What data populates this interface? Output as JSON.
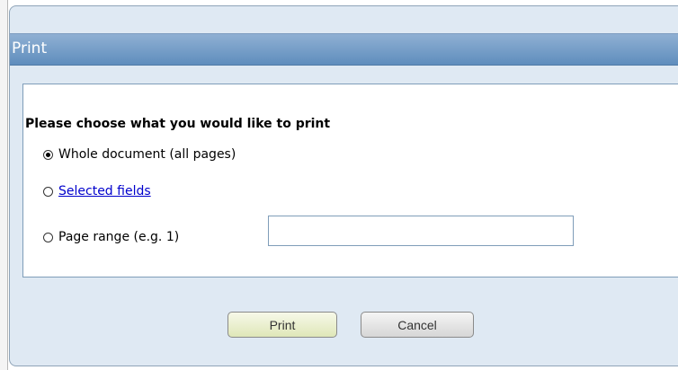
{
  "dialog": {
    "title": "Print",
    "heading": "Please choose what you would like to print",
    "options": [
      {
        "label": "Whole document (all pages)",
        "selected": true
      },
      {
        "label": "Selected fields",
        "selected": false,
        "is_link": true
      },
      {
        "label": "Page range (e.g. 1)",
        "selected": false
      }
    ],
    "page_range_value": "",
    "buttons": {
      "print": "Print",
      "cancel": "Cancel"
    }
  },
  "colors": {
    "titlebar": "#5f8dbd",
    "dialog_bg": "#dfe9f3",
    "link": "#0000cc"
  }
}
